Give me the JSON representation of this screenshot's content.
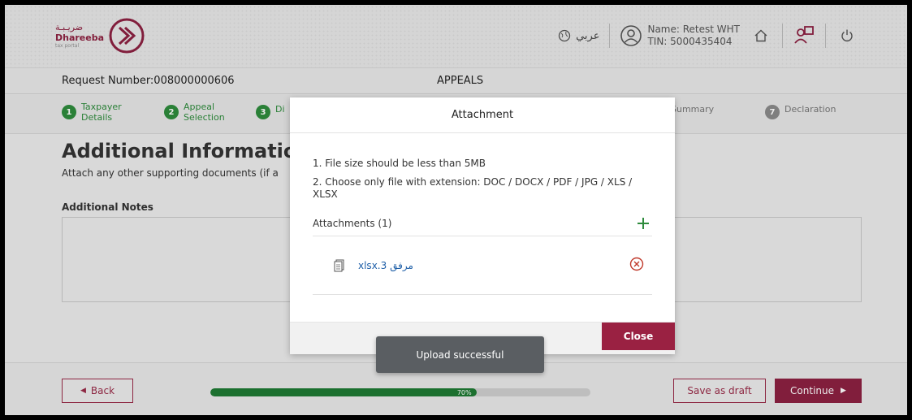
{
  "brand": {
    "name_ar": "ضريـبـة",
    "name_en": "Dhareeba",
    "tagline": "tax portal",
    "color": "#8d2142"
  },
  "header": {
    "language": "عربي",
    "user_name": "Name: Retest WHT",
    "user_tin": "TIN: 5000435404",
    "icons": [
      "globe-icon",
      "user-icon",
      "home-icon",
      "switch-user-icon",
      "power-icon"
    ]
  },
  "request": {
    "number": "Request Number:008000000606",
    "title": "APPEALS"
  },
  "steps": [
    {
      "num": "1",
      "label": "Taxpayer Details",
      "status": "done"
    },
    {
      "num": "2",
      "label": "Appeal Selection",
      "status": "done"
    },
    {
      "num": "3",
      "label": "Di",
      "status": "current"
    },
    {
      "num": "",
      "label": "Summary",
      "status": "pending"
    },
    {
      "num": "7",
      "label": "Declaration",
      "status": "pending"
    }
  ],
  "main": {
    "title": "Additional Information",
    "subtitle": "Attach any other supporting documents (if a",
    "notes_label": "Additional Notes"
  },
  "modal": {
    "title": "Attachment",
    "rule1": "1. File size should be less than 5MB",
    "rule2": "2. Choose only file with extension: DOC / DOCX / PDF / JPG / XLS / XLSX",
    "attachments_label": "Attachments (1)",
    "files": [
      {
        "name": "مرفق 3.xlsx"
      }
    ],
    "close_label": "Close"
  },
  "toast": "Upload successful",
  "footer": {
    "back_label": "Back",
    "progress_percent": 70,
    "progress_text": "70%",
    "draft_label": "Save as draft",
    "continue_label": "Continue"
  },
  "colors": {
    "green": "#2e8b3c",
    "maroon": "#8d2142",
    "progress": "#1f7a33",
    "link": "#1f5fa8",
    "remove": "#c0392b"
  }
}
